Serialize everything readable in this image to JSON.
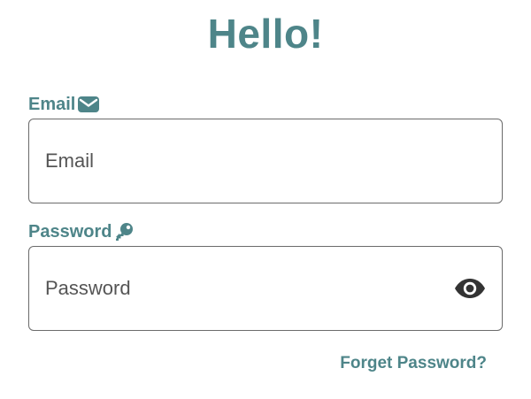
{
  "header": {
    "title": "Hello!"
  },
  "form": {
    "email": {
      "label": "Email",
      "placeholder": "Email",
      "value": "",
      "icon": "envelope-icon"
    },
    "password": {
      "label": "Password",
      "placeholder": "Password",
      "value": "",
      "icon": "key-icon",
      "toggle_icon": "eye-icon"
    },
    "forgot_password_label": "Forget Password?"
  },
  "colors": {
    "accent": "#4e8589",
    "border": "#6b6b6b",
    "text": "#555555",
    "icon_dark": "#333333"
  }
}
